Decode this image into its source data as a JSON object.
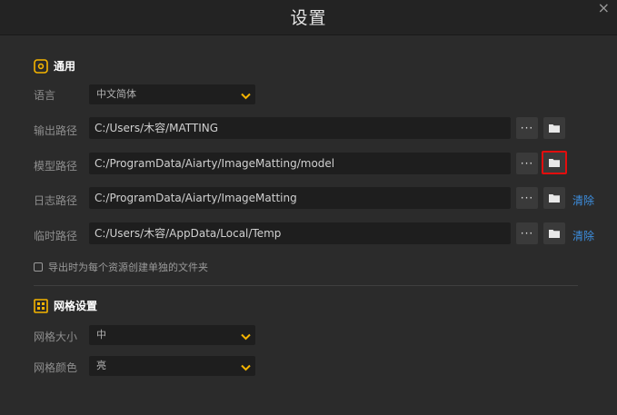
{
  "window": {
    "title": "设置",
    "close": "×"
  },
  "general": {
    "heading": "通用",
    "language": {
      "label": "语言",
      "value": "中文简体"
    },
    "rows": [
      {
        "label": "输出路径",
        "path": "C:/Users/木容/MATTING"
      },
      {
        "label": "模型路径",
        "path": "C:/ProgramData/Aiarty/ImageMatting/model"
      },
      {
        "label": "日志路径",
        "path": "C:/ProgramData/Aiarty/ImageMatting",
        "clear": "清除"
      },
      {
        "label": "临时路径",
        "path": "C:/Users/木容/AppData/Local/Temp",
        "clear": "清除"
      }
    ],
    "more_label": "···",
    "checkbox_label": "导出时为每个资源创建单独的文件夹"
  },
  "grid": {
    "heading": "网格设置",
    "size": {
      "label": "网格大小",
      "value": "中"
    },
    "color": {
      "label": "网格颜色",
      "value": "亮"
    }
  },
  "colors": {
    "accent": "#f5b400",
    "highlight": "#e30d0d",
    "link": "#3d8fe0"
  }
}
